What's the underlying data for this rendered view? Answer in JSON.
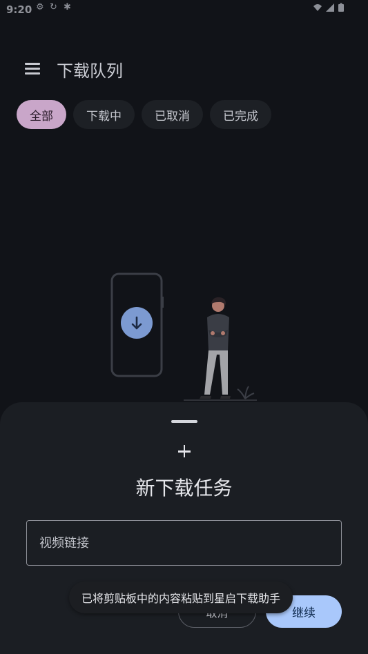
{
  "status_bar": {
    "time": "9:20",
    "left_icons": [
      "settings-icon",
      "sync-icon",
      "bug-icon"
    ],
    "right_icons": [
      "wifi-icon",
      "signal-icon",
      "battery-icon"
    ]
  },
  "header": {
    "title": "下载队列",
    "menu_icon": "menu-icon"
  },
  "filters": {
    "chips": [
      {
        "label": "全部",
        "active": true
      },
      {
        "label": "下载中",
        "active": false
      },
      {
        "label": "已取消",
        "active": false
      },
      {
        "label": "已完成",
        "active": false
      }
    ]
  },
  "sheet": {
    "title": "新下载任务",
    "url_placeholder": "视频链接",
    "url_value": "",
    "cancel_label": "取消",
    "continue_label": "继续"
  },
  "toast": {
    "message": "已将剪贴板中的内容粘贴到星启下载助手"
  },
  "colors": {
    "background": "#111318",
    "sheet": "#1b1e23",
    "active_chip": "#c9a6c9",
    "primary_button": "#a9c8fb",
    "accent_circle": "#7c9ad1"
  }
}
